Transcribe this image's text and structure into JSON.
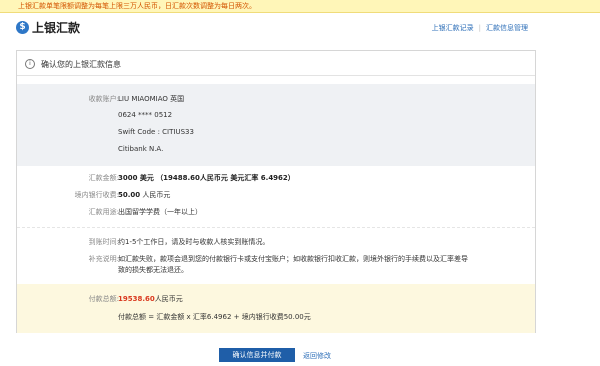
{
  "notice": "上银汇款单笔限额调整为每笔上限三万人民币，日汇款次数调整为每日两次。",
  "header": {
    "logo_glyph": "$",
    "title": "上银汇款",
    "links": [
      "上银汇款记录",
      "汇款信息管理"
    ]
  },
  "card": {
    "title": "确认您的上银汇款信息",
    "payee": {
      "label": "收款账户:",
      "name": "LIU MIAOMIAO 英国",
      "account": "0624 **** 0512",
      "swift": "Swift Code : CITIUS33",
      "bank": "Citibank N.A."
    },
    "amount": {
      "label": "汇款金额:",
      "main": "3000 美元",
      "detail": "（19488.60人民币元 美元汇率 6.4962）"
    },
    "fee": {
      "label": "境内银行收费:",
      "main": "50.00",
      "unit": "人民币元"
    },
    "purpose": {
      "label": "汇款用途:",
      "value": "出国留学学费（一年以上）"
    },
    "arrival": {
      "label": "到账时间:",
      "value": "约1-5个工作日，请及时与收款人核实到账情况。"
    },
    "note": {
      "label": "补充说明:",
      "line1": "如汇款失败，款项会退到您的付款银行卡或支付宝账户；如收款银行扣收汇款，则境外银行的手续费以及汇率差导",
      "line2": "致的损失都无法退还。"
    },
    "total": {
      "label": "付款总额:",
      "amount": "19538.60",
      "unit": "人民币元",
      "formula": "付款总额 = 汇款金额 x 汇率6.4962 + 境内银行收费50.00元"
    }
  },
  "actions": {
    "confirm": "确认信息并付款",
    "back": "返回修改"
  }
}
